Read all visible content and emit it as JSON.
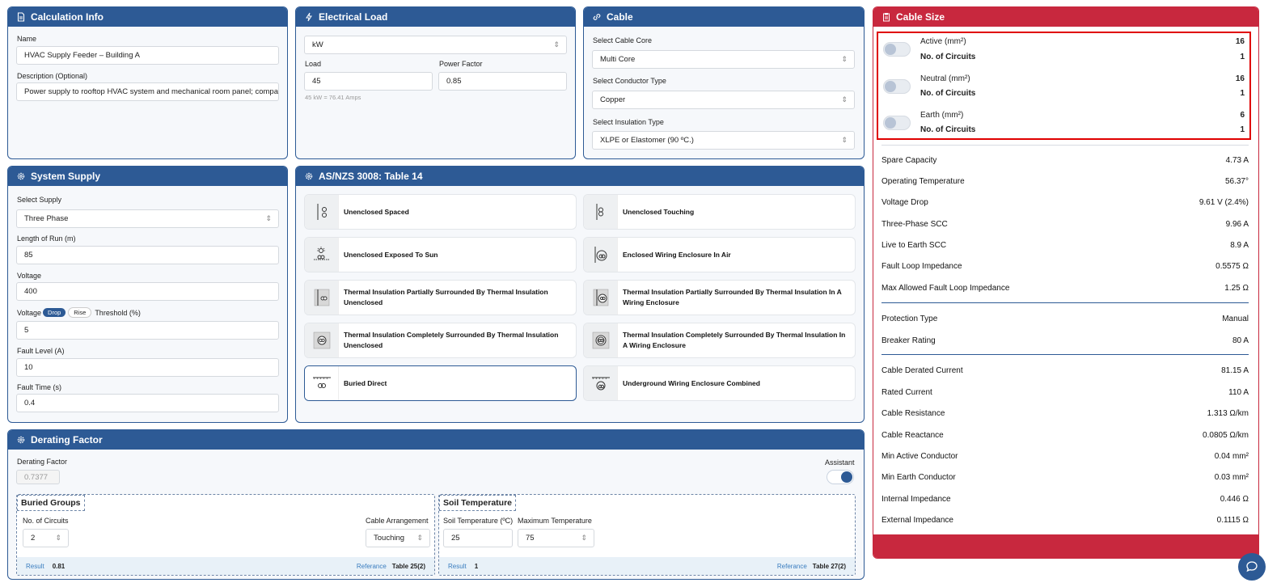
{
  "calc_info": {
    "title": "Calculation Info",
    "name_label": "Name",
    "name_value": "HVAC Supply Feeder – Building A",
    "desc_label": "Description (Optional)",
    "desc_value": "Power supply to rooftop HVAC system and mechanical room panel; comparis"
  },
  "electrical_load": {
    "title": "Electrical Load",
    "unit": "kW",
    "load_label": "Load",
    "load_value": "45",
    "pf_label": "Power Factor",
    "pf_value": "0.85",
    "hint": "45 kW = 76.41 Amps"
  },
  "cable": {
    "title": "Cable",
    "core_label": "Select Cable Core",
    "core_value": "Multi Core",
    "conductor_label": "Select Conductor Type",
    "conductor_value": "Copper",
    "insulation_label": "Select Insulation Type",
    "insulation_value": "XLPE or Elastomer (90 ºC.)"
  },
  "system_supply": {
    "title": "System Supply",
    "supply_label": "Select Supply",
    "supply_value": "Three Phase",
    "length_label": "Length of Run (m)",
    "length_value": "85",
    "voltage_label": "Voltage",
    "voltage_value": "400",
    "vd_prefix": "Voltage",
    "vd_drop": "Drop",
    "vd_rise": "Rise",
    "vd_suffix": "Threshold (%)",
    "vd_value": "5",
    "fault_level_label": "Fault Level (A)",
    "fault_level_value": "10",
    "fault_time_label": "Fault Time (s)",
    "fault_time_value": "0.4"
  },
  "table14": {
    "title": "AS/NZS 3008: Table 14",
    "items": [
      {
        "label": "Unenclosed Spaced",
        "icon": "spaced-icon"
      },
      {
        "label": "Unenclosed Touching",
        "icon": "touching-icon"
      },
      {
        "label": "Unenclosed Exposed To Sun",
        "icon": "sun-icon"
      },
      {
        "label": "Enclosed Wiring Enclosure In Air",
        "icon": "enclosure-air-icon"
      },
      {
        "label": "Thermal Insulation Partially Surrounded By Thermal Insulation Unenclosed",
        "icon": "thermal-partial-icon"
      },
      {
        "label": "Thermal Insulation Partially Surrounded By Thermal Insulation In A Wiring Enclosure",
        "icon": "thermal-partial-enclosure-icon"
      },
      {
        "label": "Thermal Insulation Completely Surrounded By Thermal Insulation Unenclosed",
        "icon": "thermal-complete-icon"
      },
      {
        "label": "Thermal Insulation Completely Surrounded By Thermal Insulation In A Wiring Enclosure",
        "icon": "thermal-complete-enclosure-icon"
      },
      {
        "label": "Buried Direct",
        "icon": "buried-direct-icon"
      },
      {
        "label": "Underground Wiring Enclosure Combined",
        "icon": "underground-enclosure-icon"
      }
    ]
  },
  "derating": {
    "title": "Derating Factor",
    "factor_label": "Derating Factor",
    "factor_value": "0.7377",
    "assistant_label": "Assistant",
    "buried": {
      "title": "Buried Groups",
      "circuits_label": "No. of Circuits",
      "circuits_value": "2",
      "arrangement_label": "Cable Arrangement",
      "arrangement_value": "Touching",
      "result_label": "Result",
      "result_value": "0.81",
      "ref_label": "Referance",
      "ref_value": "Table 25(2)"
    },
    "soil": {
      "title": "Soil Temperature",
      "soil_label": "Soil Temperature (ºC)",
      "soil_value": "25",
      "max_label": "Maximum Temperature",
      "max_value": "75",
      "result_label": "Result",
      "result_value": "1",
      "ref_label": "Referance",
      "ref_value": "Table 27(2)"
    }
  },
  "cable_size": {
    "title": "Cable Size",
    "conductors": [
      {
        "label": "Active (mm²)",
        "value": "16",
        "circ_label": "No. of Circuits",
        "circ_value": "1"
      },
      {
        "label": "Neutral (mm²)",
        "value": "16",
        "circ_label": "No. of Circuits",
        "circ_value": "1"
      },
      {
        "label": "Earth (mm²)",
        "value": "6",
        "circ_label": "No. of Circuits",
        "circ_value": "1"
      }
    ],
    "group1": [
      {
        "label": "Spare Capacity",
        "value": "4.73 A"
      },
      {
        "label": "Operating Temperature",
        "value": "56.37°"
      },
      {
        "label": "Voltage Drop",
        "value": "9.61 V (2.4%)"
      },
      {
        "label": "Three-Phase SCC",
        "value": "9.96 A"
      },
      {
        "label": "Live to Earth SCC",
        "value": "8.9 A"
      },
      {
        "label": "Fault Loop Impedance",
        "value": "0.5575 Ω"
      },
      {
        "label": "Max Allowed Fault Loop Impedance",
        "value": "1.25 Ω"
      }
    ],
    "group2": [
      {
        "label": "Protection Type",
        "value": "Manual"
      },
      {
        "label": "Breaker Rating",
        "value": "80 A"
      }
    ],
    "group3": [
      {
        "label": "Cable Derated Current",
        "value": "81.15 A"
      },
      {
        "label": "Rated Current",
        "value": "110 A"
      },
      {
        "label": "Cable Resistance",
        "value": "1.313 Ω/km"
      },
      {
        "label": "Cable Reactance",
        "value": "0.0805 Ω/km"
      },
      {
        "label": "Min Active Conductor",
        "value": "0.04 mm²"
      },
      {
        "label": "Min Earth Conductor",
        "value": "0.03 mm²"
      },
      {
        "label": "Internal Impedance",
        "value": "0.446 Ω"
      },
      {
        "label": "External Impedance",
        "value": "0.1115 Ω"
      }
    ]
  },
  "colors": {
    "primary": "#2d5a95",
    "accent": "#c8283e",
    "highlight": "#e00000"
  }
}
